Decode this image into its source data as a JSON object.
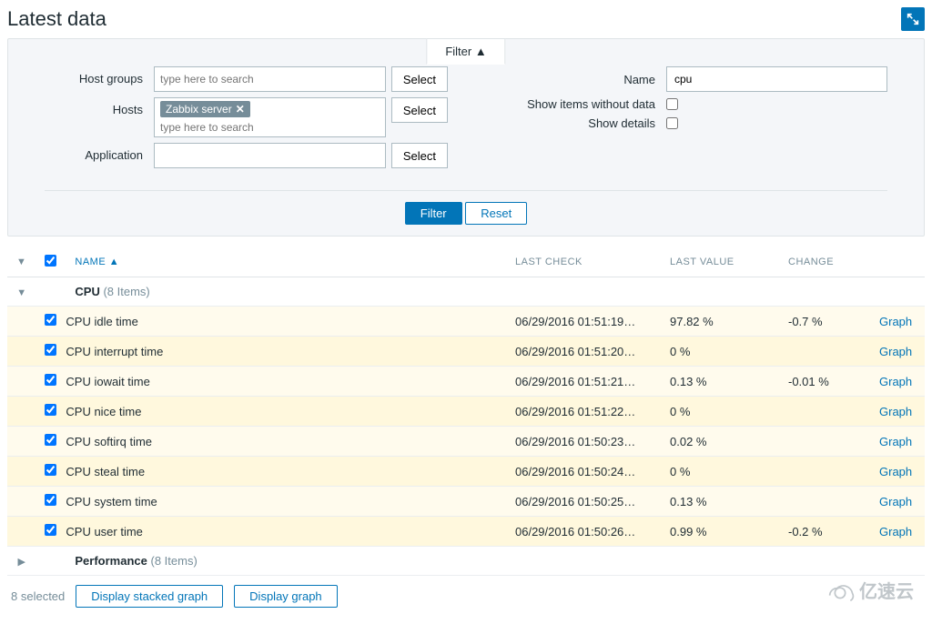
{
  "page_title": "Latest data",
  "filter_tab_label": "Filter ▲",
  "filter": {
    "labels": {
      "host_groups": "Host groups",
      "hosts": "Hosts",
      "application": "Application",
      "name": "Name",
      "show_without_data": "Show items without data",
      "show_details": "Show details"
    },
    "placeholders": {
      "search": "type here to search"
    },
    "values": {
      "host_groups": "",
      "hosts_tag": "Zabbix server",
      "application": "",
      "name": "cpu"
    },
    "buttons": {
      "select": "Select",
      "filter": "Filter",
      "reset": "Reset"
    }
  },
  "table": {
    "headers": {
      "name": "NAME",
      "last_check": "LAST CHECK",
      "last_value": "LAST VALUE",
      "change": "CHANGE"
    },
    "sort_arrow": "▲",
    "groups": [
      {
        "name": "CPU",
        "count": "(8 Items)",
        "expanded": true
      },
      {
        "name": "Performance",
        "count": "(8 Items)",
        "expanded": false
      }
    ],
    "items": [
      {
        "name": "CPU idle time",
        "check": "06/29/2016 01:51:19…",
        "value": "97.82 %",
        "change": "-0.7 %",
        "action": "Graph"
      },
      {
        "name": "CPU interrupt time",
        "check": "06/29/2016 01:51:20…",
        "value": "0 %",
        "change": "",
        "action": "Graph"
      },
      {
        "name": "CPU iowait time",
        "check": "06/29/2016 01:51:21…",
        "value": "0.13 %",
        "change": "-0.01 %",
        "action": "Graph"
      },
      {
        "name": "CPU nice time",
        "check": "06/29/2016 01:51:22…",
        "value": "0 %",
        "change": "",
        "action": "Graph"
      },
      {
        "name": "CPU softirq time",
        "check": "06/29/2016 01:50:23…",
        "value": "0.02 %",
        "change": "",
        "action": "Graph"
      },
      {
        "name": "CPU steal time",
        "check": "06/29/2016 01:50:24…",
        "value": "0 %",
        "change": "",
        "action": "Graph"
      },
      {
        "name": "CPU system time",
        "check": "06/29/2016 01:50:25…",
        "value": "0.13 %",
        "change": "",
        "action": "Graph"
      },
      {
        "name": "CPU user time",
        "check": "06/29/2016 01:50:26…",
        "value": "0.99 %",
        "change": "-0.2 %",
        "action": "Graph"
      }
    ]
  },
  "footer": {
    "selected_count": "8 selected",
    "stacked_btn": "Display stacked graph",
    "graph_btn": "Display graph"
  },
  "watermark": "亿速云"
}
